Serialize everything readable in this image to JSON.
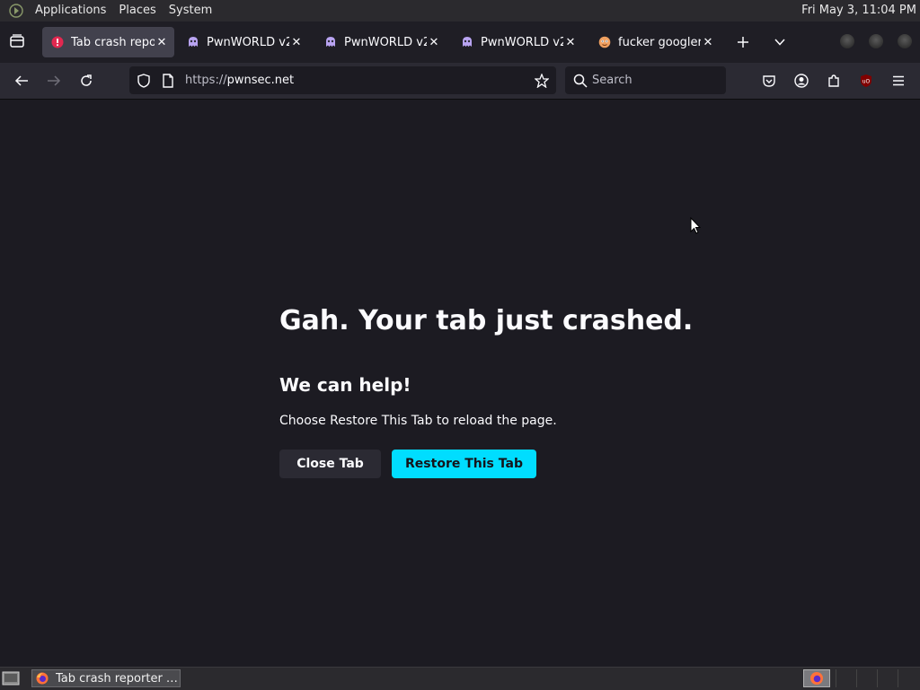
{
  "top_panel": {
    "menus": [
      "Applications",
      "Places",
      "System"
    ],
    "clock": "Fri May  3, 11:04 PM"
  },
  "tabs": [
    {
      "title": "Tab crash reporter",
      "icon": "crash-alert-icon",
      "active": true
    },
    {
      "title": "PwnWORLD v2",
      "icon": "pwn-ghost-icon",
      "active": false
    },
    {
      "title": "PwnWORLD v2",
      "icon": "pwn-ghost-icon",
      "active": false
    },
    {
      "title": "PwnWORLD v2",
      "icon": "pwn-ghost-icon",
      "active": false
    },
    {
      "title": "fucker googler",
      "icon": "googler-face-icon",
      "active": false
    }
  ],
  "navbar": {
    "url_protocol": "https://",
    "url_host": "pwnsec.net",
    "search_placeholder": "Search"
  },
  "crash_page": {
    "title": "Gah. Your tab just crashed.",
    "subtitle": "We can help!",
    "message": "Choose Restore This Tab to reload the page.",
    "close_button": "Close Tab",
    "restore_button": "Restore This Tab"
  },
  "taskbar": {
    "task_label": "Tab crash reporter …"
  },
  "colors": {
    "accent": "#00ddff",
    "page_bg": "#1c1b22",
    "toolbar_bg": "#2b2a33",
    "crash_icon": "#e22850"
  }
}
